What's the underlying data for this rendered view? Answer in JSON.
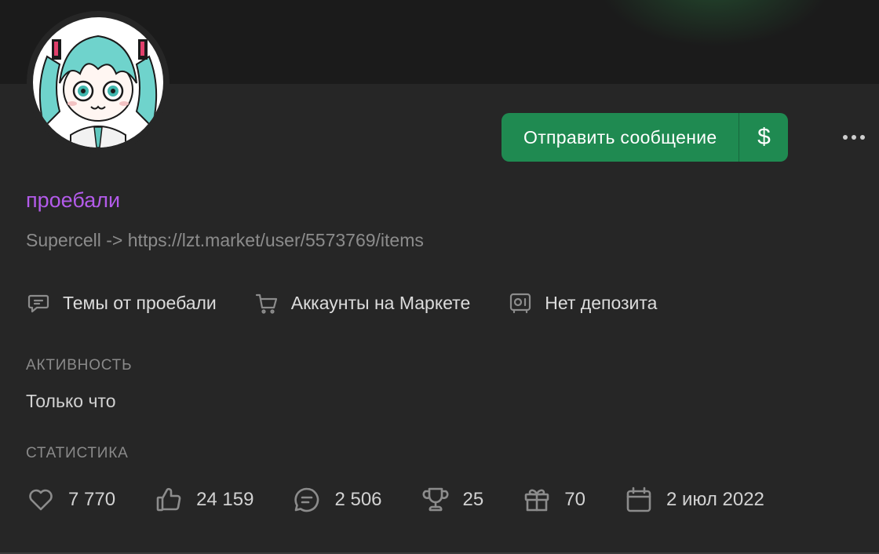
{
  "profile": {
    "username": "проебали",
    "status_text": "Supercell -> https://lzt.market/user/5573769/items",
    "username_color": "#b35bea"
  },
  "actions": {
    "send_message_label": "Отправить сообщение",
    "money_label": "$",
    "accent_color": "#1f8a51"
  },
  "links": [
    {
      "icon": "chat-icon",
      "label": "Темы от проебали"
    },
    {
      "icon": "cart-icon",
      "label": "Аккаунты на Маркете"
    },
    {
      "icon": "safe-icon",
      "label": "Нет депозита"
    }
  ],
  "activity": {
    "heading": "АКТИВНОСТЬ",
    "value": "Только что"
  },
  "statistics": {
    "heading": "СТАТИСТИКА",
    "items": [
      {
        "icon": "heart-icon",
        "value": "7 770"
      },
      {
        "icon": "thumbs-up-icon",
        "value": "24 159"
      },
      {
        "icon": "message-icon",
        "value": "2 506"
      },
      {
        "icon": "trophy-icon",
        "value": "25"
      },
      {
        "icon": "gift-icon",
        "value": "70"
      },
      {
        "icon": "calendar-icon",
        "value": "2 июл 2022"
      }
    ]
  }
}
